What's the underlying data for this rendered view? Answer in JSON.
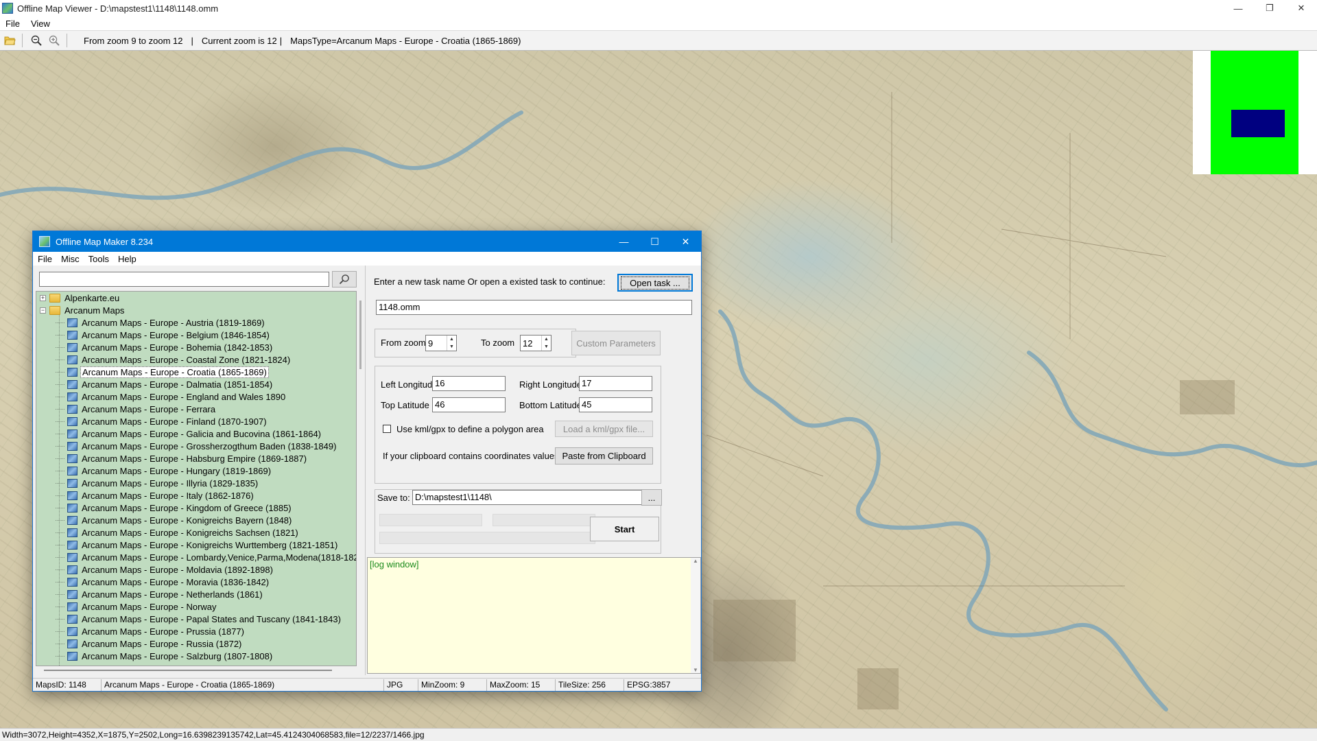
{
  "viewer": {
    "title": "Offline Map Viewer - D:\\mapstest1\\1148\\1148.omm",
    "menu": [
      "File",
      "View"
    ],
    "toolbar": {
      "zoom_range": "From zoom 9 to zoom 12",
      "current_zoom": "Current zoom is 12",
      "maps_type": "MapsType=Arcanum Maps - Europe - Croatia (1865-1869)"
    },
    "window_controls": {
      "minimize": "—",
      "maximize": "❐",
      "close": "✕"
    },
    "status": "Width=3072,Height=4352,X=1875,Y=2502,Long=16.6398239135742,Lat=45.4124304068583,file=12/2237/1466.jpg"
  },
  "dialog": {
    "title": "Offline Map Maker 8.234",
    "window_controls": {
      "minimize": "—",
      "maximize": "☐",
      "close": "✕"
    },
    "menu": [
      "File",
      "Misc",
      "Tools",
      "Help"
    ],
    "search": {
      "value": "",
      "icon": "search-icon"
    },
    "tree": {
      "root_folders": [
        {
          "label": "Alpenkarte.eu",
          "expander": "+"
        },
        {
          "label": "Arcanum Maps",
          "expander": "−"
        }
      ],
      "items": [
        "Arcanum Maps - Europe - Austria (1819-1869)",
        "Arcanum Maps - Europe - Belgium (1846-1854)",
        "Arcanum Maps - Europe - Bohemia (1842-1853)",
        "Arcanum Maps - Europe - Coastal Zone (1821-1824)",
        "Arcanum Maps - Europe - Croatia (1865-1869)",
        "Arcanum Maps - Europe - Dalmatia (1851-1854)",
        "Arcanum Maps - Europe - England and Wales 1890",
        "Arcanum Maps - Europe - Ferrara",
        "Arcanum Maps - Europe - Finland (1870-1907)",
        "Arcanum Maps - Europe - Galicia and Bucovina (1861-1864)",
        "Arcanum Maps - Europe - Grossherzogthum Baden (1838-1849)",
        "Arcanum Maps - Europe - Habsburg Empire (1869-1887)",
        "Arcanum Maps - Europe - Hungary (1819-1869)",
        "Arcanum Maps - Europe - Illyria (1829-1835)",
        "Arcanum Maps - Europe - Italy (1862-1876)",
        "Arcanum Maps - Europe - Kingdom of Greece (1885)",
        "Arcanum Maps - Europe - Konigreichs Bayern (1848)",
        "Arcanum Maps - Europe - Konigreichs Sachsen (1821)",
        "Arcanum Maps - Europe - Konigreichs Wurttemberg (1821-1851)",
        "Arcanum Maps - Europe - Lombardy,Venice,Parma,Modena(1818-182",
        "Arcanum Maps - Europe - Moldavia (1892-1898)",
        "Arcanum Maps - Europe - Moravia (1836-1842)",
        "Arcanum Maps - Europe - Netherlands (1861)",
        "Arcanum Maps - Europe - Norway",
        "Arcanum Maps - Europe - Papal States and Tuscany (1841-1843)",
        "Arcanum Maps - Europe - Prussia (1877)",
        "Arcanum Maps - Europe - Russia (1872)",
        "Arcanum Maps - Europe - Salzburg (1807-1808)"
      ],
      "selected_index": 4
    },
    "task": {
      "prompt": "Enter a new task name Or open a existed task to continue:",
      "open_button": "Open task ...",
      "name_value": "1148.omm"
    },
    "zoom": {
      "from_label": "From zoom",
      "from_value": "9",
      "to_label": "To zoom",
      "to_value": "12",
      "custom_button": "Custom Parameters"
    },
    "coords": {
      "left_lon_label": "Left Longitude",
      "left_lon_value": "16",
      "right_lon_label": "Right Longitude",
      "right_lon_value": "17",
      "top_lat_label": "Top Latitude",
      "top_lat_value": "46",
      "bottom_lat_label": "Bottom Latitude",
      "bottom_lat_value": "45",
      "kml_checkbox_label": "Use kml/gpx to define a polygon area",
      "kml_checked": false,
      "kml_button": "Load a kml/gpx file...",
      "clipboard_label": "If your clipboard contains coordinates values:",
      "clipboard_button": "Paste from Clipboard"
    },
    "save": {
      "label": "Save to:",
      "path_value": "D:\\mapstest1\\1148\\",
      "browse_button": "...",
      "start_button": "Start"
    },
    "log": {
      "text": "[log window]"
    },
    "status": {
      "maps_id": "MapsID: 1148",
      "map_name": "Arcanum Maps - Europe - Croatia (1865-1869)",
      "format": "JPG",
      "min_zoom": "MinZoom: 9",
      "max_zoom": "MaxZoom: 15",
      "tile_size": "TileSize: 256",
      "epsg": "EPSG:3857"
    }
  },
  "colors": {
    "accent": "#0078d7",
    "tree_background": "#c0dcc0",
    "log_background": "#ffffe0",
    "log_text": "#1a8a1a",
    "minimap_bounds": "#00ff00",
    "minimap_viewport": "#000080"
  }
}
